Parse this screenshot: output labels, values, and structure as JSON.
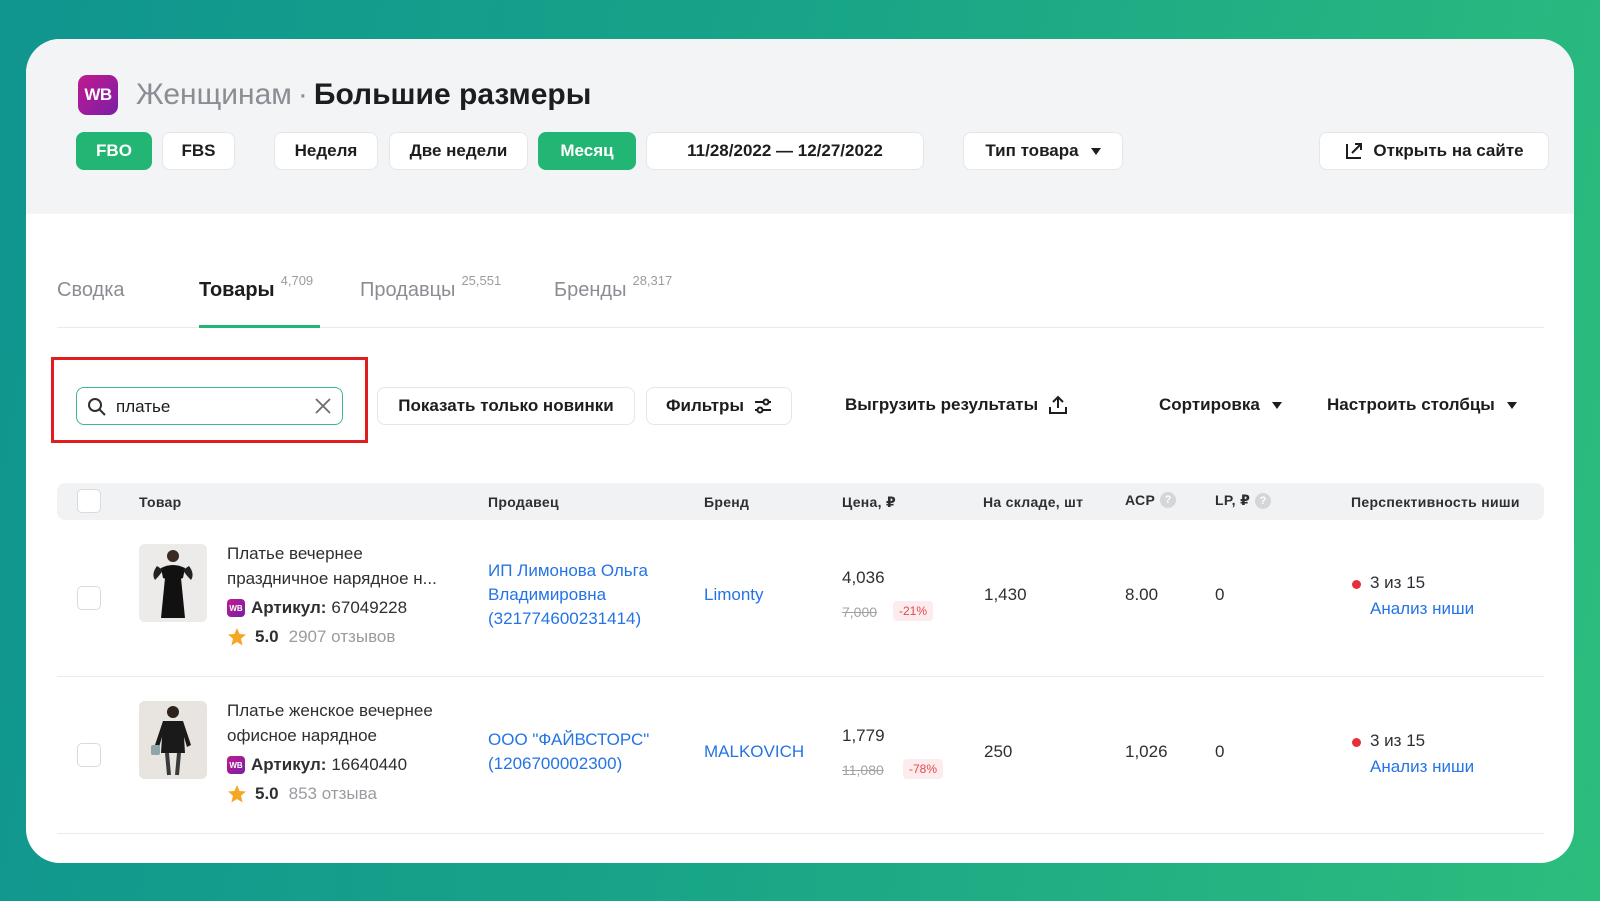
{
  "header": {
    "logo": "WB",
    "crumb": "Женщинам",
    "separator": "·",
    "title": "Большие размеры"
  },
  "toolbar": {
    "fbo": "FBO",
    "fbs": "FBS",
    "week": "Неделя",
    "two_weeks": "Две недели",
    "month": "Месяц",
    "date_range": "11/28/2022 — 12/27/2022",
    "product_type": "Тип товара",
    "open_site": "Открыть на сайте"
  },
  "tabs": [
    {
      "label": "Сводка",
      "count": ""
    },
    {
      "label": "Товары",
      "count": "4,709"
    },
    {
      "label": "Продавцы",
      "count": "25,551"
    },
    {
      "label": "Бренды",
      "count": "28,317"
    }
  ],
  "search": {
    "value": "платье"
  },
  "actions": {
    "new_only": "Показать только новинки",
    "filters": "Фильтры",
    "export": "Выгрузить результаты",
    "sort": "Сортировка",
    "columns": "Настроить столбцы"
  },
  "table": {
    "columns": {
      "product": "Товар",
      "seller": "Продавец",
      "brand": "Бренд",
      "price": "Цена, ₽",
      "stock": "На складе, шт",
      "acp": "АСР",
      "lp": "LP, ₽",
      "niche": "Перспективность ниши"
    },
    "rows": [
      {
        "name": "Платье вечернее праздничное нарядное н...",
        "article_label": "Артикул:",
        "article": "67049228",
        "rating": "5.0",
        "reviews": "2907 отзывов",
        "seller": [
          "ИП Лимонова Ольга",
          "Владимировна",
          "(321774600231414)"
        ],
        "brand": "Limonty",
        "price": "4,036",
        "old_price": "7,000",
        "discount": "-21%",
        "stock": "1,430",
        "acp": "8.00",
        "lp": "0",
        "niche_score": "3 из 15",
        "niche_link": "Анализ ниши"
      },
      {
        "name": "Платье женское вечернее офисное нарядное",
        "article_label": "Артикул:",
        "article": "16640440",
        "rating": "5.0",
        "reviews": "853 отзыва",
        "seller": [
          "ООО \"ФАЙВСТОРС\"",
          "(1206700002300)"
        ],
        "brand": "MALKOVICH",
        "price": "1,779",
        "old_price": "11,080",
        "discount": "-78%",
        "stock": "250",
        "acp": "1,026",
        "lp": "0",
        "niche_score": "3 из 15",
        "niche_link": "Анализ ниши"
      }
    ]
  },
  "colors": {
    "accent": "#22b573",
    "link": "#2474e5",
    "highlight": "#e01e1e"
  }
}
